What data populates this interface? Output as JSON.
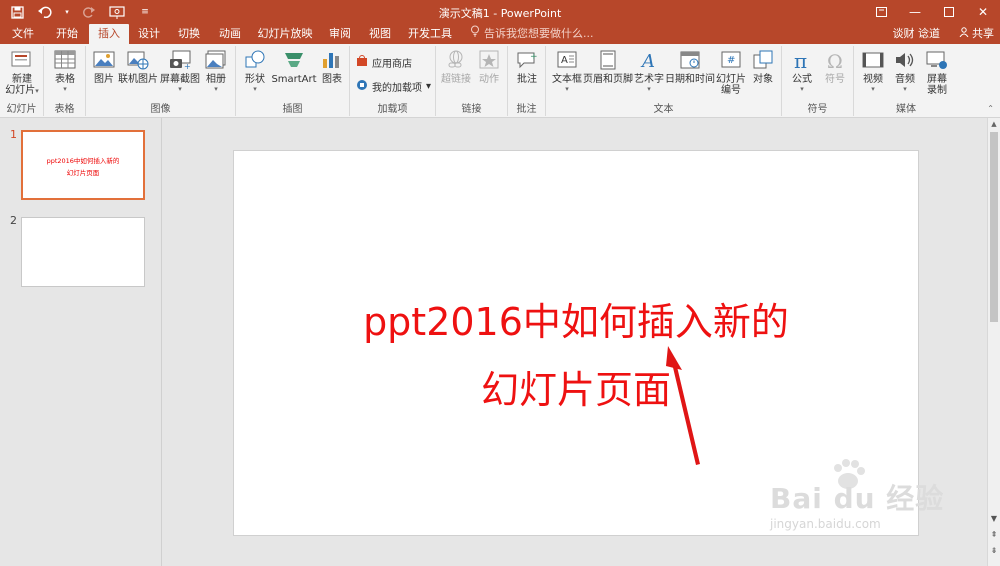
{
  "window": {
    "title": "演示文稿1 - PowerPoint",
    "accent": "#b7472a",
    "tab_bg": "#f3f3f3"
  },
  "qat": {
    "save_icon": "save-icon",
    "undo_icon": "undo-icon",
    "redo_icon": "redo-icon",
    "present_icon": "present-from-start-icon",
    "customize_icon": "customize-qat-icon"
  },
  "tabs": [
    {
      "label": "文件",
      "active": false
    },
    {
      "label": "开始",
      "active": false
    },
    {
      "label": "插入",
      "active": true
    },
    {
      "label": "设计",
      "active": false
    },
    {
      "label": "切换",
      "active": false
    },
    {
      "label": "动画",
      "active": false
    },
    {
      "label": "幻灯片放映",
      "active": false
    },
    {
      "label": "审阅",
      "active": false
    },
    {
      "label": "视图",
      "active": false
    },
    {
      "label": "开发工具",
      "active": false
    }
  ],
  "tell_me": "告诉我您想要做什么...",
  "user": "谈财 谂道",
  "share": "共享",
  "ribbon": {
    "groups": {
      "slides": "幻灯片",
      "tables": "表格",
      "images": "图像",
      "illustrations": "插图",
      "addins": "加载项",
      "links": "链接",
      "comments": "批注",
      "text": "文本",
      "symbols": "符号",
      "media": "媒体"
    },
    "buttons": {
      "new_slide_1": "新建",
      "new_slide_2": "幻灯片",
      "table": "表格",
      "picture": "图片",
      "online_picture": "联机图片",
      "screenshot": "屏幕截图",
      "album": "相册",
      "shapes": "形状",
      "smartart": "SmartArt",
      "chart": "图表",
      "store": "应用商店",
      "my_addins": "我的加载项",
      "hyperlink": "超链接",
      "action": "动作",
      "comment": "批注",
      "textbox": "文本框",
      "header_footer": "页眉和页脚",
      "wordart": "艺术字",
      "datetime": "日期和时间",
      "slide_number_1": "幻灯片",
      "slide_number_2": "编号",
      "object": "对象",
      "equation": "公式",
      "symbol": "符号",
      "video": "视频",
      "audio": "音频",
      "screen_record_1": "屏幕",
      "screen_record_2": "录制"
    }
  },
  "slides": [
    {
      "number": "1",
      "line1": "ppt2016中如何插入新的",
      "line2": "幻灯片页面",
      "active": true
    },
    {
      "number": "2",
      "line1": "",
      "line2": "",
      "active": false
    }
  ],
  "main_slide": {
    "line1": "ppt2016中如何插入新的",
    "line2": "幻灯片页面",
    "text_color": "#ee1111"
  },
  "watermark": {
    "main": "Bai du 经验",
    "url": "jingyan.baidu.com"
  }
}
